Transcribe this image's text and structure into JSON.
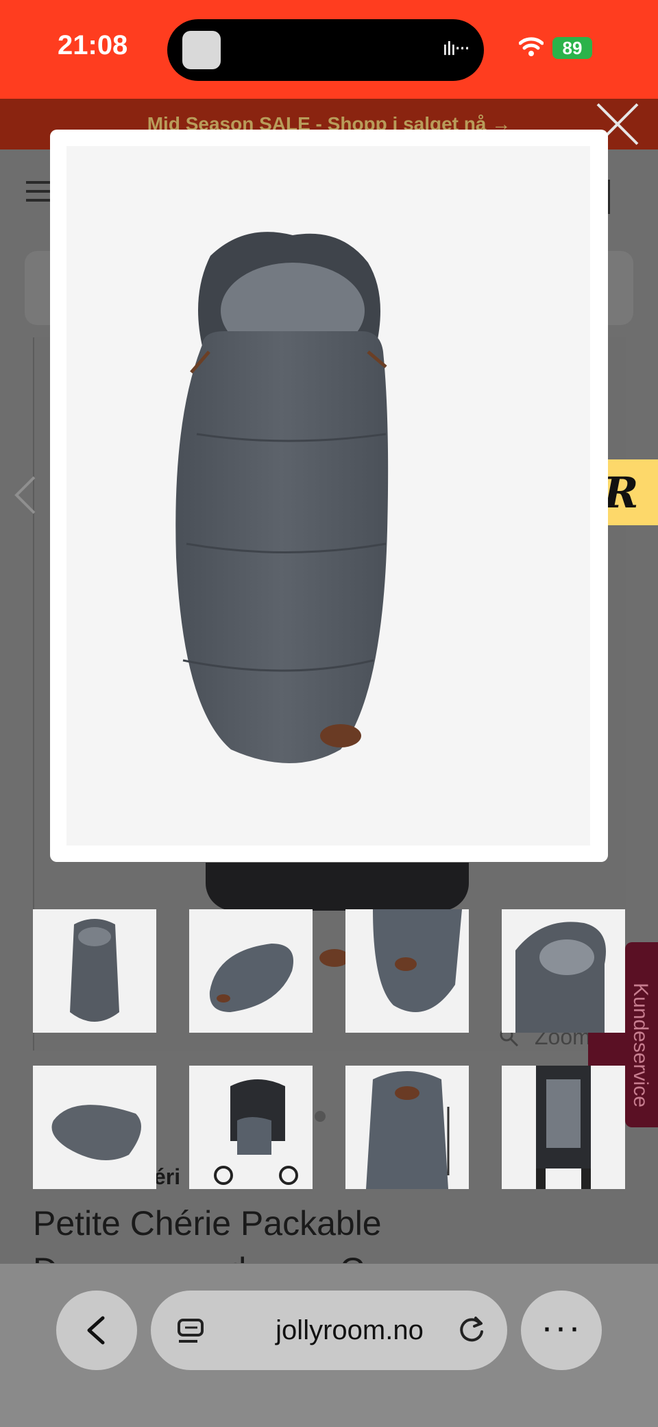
{
  "status_bar": {
    "time": "21:08",
    "battery": "89"
  },
  "promo": {
    "text": "Mid Season SALE - Shopp i salget nå →"
  },
  "gallery": {
    "zoom_label": "Zoom"
  },
  "product": {
    "brand_partial": "éri",
    "title_line1": "Petite Chérie Packable",
    "title_line2": "Dunpose med pose C"
  },
  "widgets": {
    "r_letter": "R",
    "customer_service": "Kundeservice"
  },
  "lightbox": {
    "thumbnails": [
      "footmuff-front",
      "footmuff-angled",
      "footmuff-bottom",
      "footmuff-hood-detail",
      "footmuff-flat",
      "footmuff-in-stroller",
      "footmuff-packed-bag",
      "stroller-front"
    ]
  },
  "browser": {
    "url": "jollyroom.no"
  },
  "colors": {
    "status_bar": "#ff3d1f",
    "promo": "#8a2410",
    "widget_yellow": "#fdd86a",
    "customer_service": "#5a1024"
  }
}
